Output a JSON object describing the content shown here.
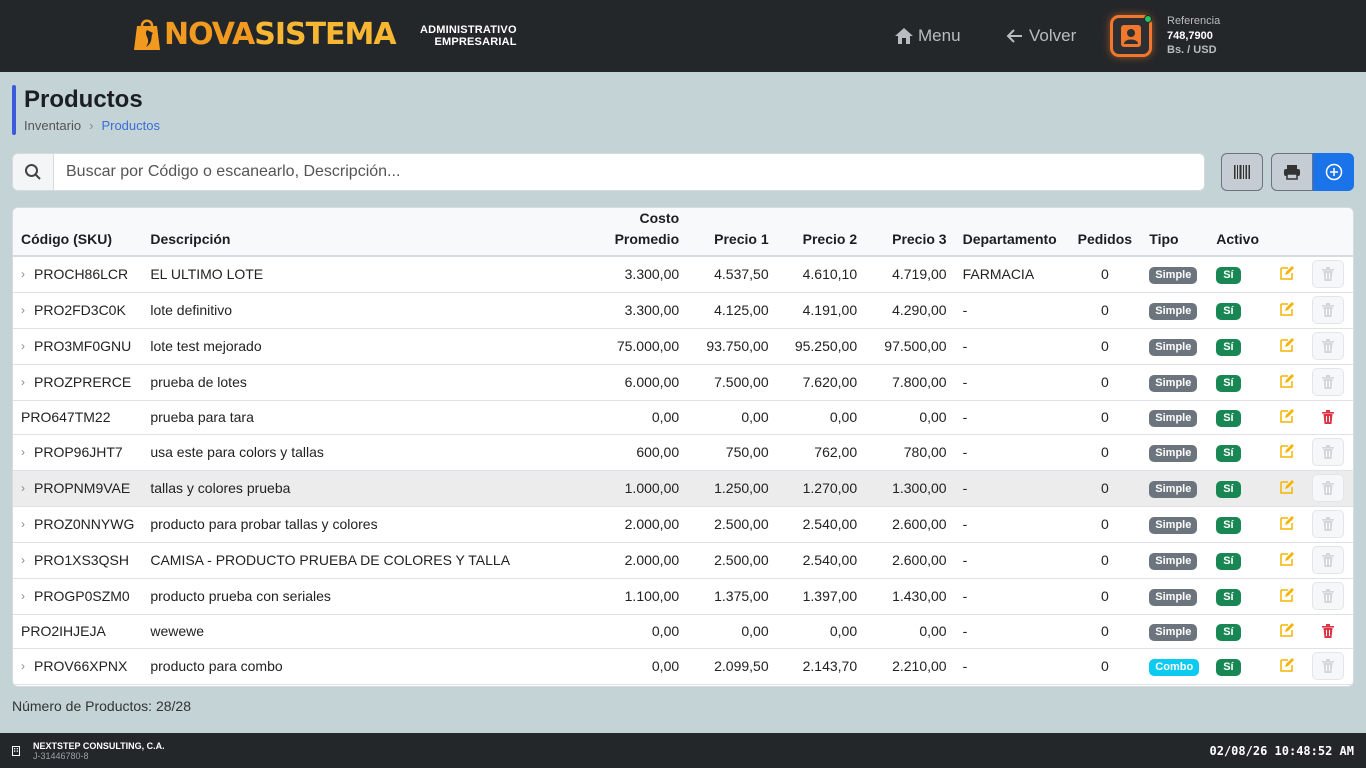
{
  "header": {
    "logo_part1": "NOVA",
    "logo_part2": "SISTEMA",
    "tagline_line1": "ADMINISTRATIVO",
    "tagline_line2": "EMPRESARIAL",
    "menu_label": "Menu",
    "back_label": "Volver",
    "reference_label": "Referencia",
    "reference_value": "748,7900",
    "reference_unit": "Bs. / USD"
  },
  "page": {
    "title": "Productos",
    "breadcrumb": [
      "Inventario",
      "Productos"
    ]
  },
  "search": {
    "placeholder": "Buscar por Código o escanearlo, Descripción..."
  },
  "table": {
    "columns": [
      "Código (SKU)",
      "Descripción",
      "Costo Promedio",
      "Precio 1",
      "Precio 2",
      "Precio 3",
      "Departamento",
      "Pedidos",
      "Tipo",
      "Activo"
    ],
    "rows": [
      {
        "sku": "PROCH86LCR",
        "desc": "EL ULTIMO LOTE",
        "cost": "3.300,00",
        "p1": "4.537,50",
        "p2": "4.610,10",
        "p3": "4.719,00",
        "dept": "FARMACIA",
        "orders": "0",
        "type": "Simple",
        "active": "Sí"
      },
      {
        "sku": "PRO2FD3C0K",
        "desc": "lote definitivo",
        "cost": "3.300,00",
        "p1": "4.125,00",
        "p2": "4.191,00",
        "p3": "4.290,00",
        "dept": "-",
        "orders": "0",
        "type": "Simple",
        "active": "Sí"
      },
      {
        "sku": "PRO3MF0GNU",
        "desc": "lote test mejorado",
        "cost": "75.000,00",
        "p1": "93.750,00",
        "p2": "95.250,00",
        "p3": "97.500,00",
        "dept": "-",
        "orders": "0",
        "type": "Simple",
        "active": "Sí"
      },
      {
        "sku": "PROZPRERCE",
        "desc": "prueba de lotes",
        "cost": "6.000,00",
        "p1": "7.500,00",
        "p2": "7.620,00",
        "p3": "7.800,00",
        "dept": "-",
        "orders": "0",
        "type": "Simple",
        "active": "Sí"
      },
      {
        "sku": "PRO647TM22",
        "desc": "prueba para tara",
        "cost": "0,00",
        "p1": "0,00",
        "p2": "0,00",
        "p3": "0,00",
        "dept": "-",
        "orders": "0",
        "type": "Simple",
        "active": "Sí"
      },
      {
        "sku": "PROP96JHT7",
        "desc": "usa este para colors y tallas",
        "cost": "600,00",
        "p1": "750,00",
        "p2": "762,00",
        "p3": "780,00",
        "dept": "-",
        "orders": "0",
        "type": "Simple",
        "active": "Sí"
      },
      {
        "sku": "PROPNM9VAE",
        "desc": "tallas y colores prueba",
        "cost": "1.000,00",
        "p1": "1.250,00",
        "p2": "1.270,00",
        "p3": "1.300,00",
        "dept": "-",
        "orders": "0",
        "type": "Simple",
        "active": "Sí"
      },
      {
        "sku": "PROZ0NNYWG",
        "desc": "producto para probar tallas y colores",
        "cost": "2.000,00",
        "p1": "2.500,00",
        "p2": "2.540,00",
        "p3": "2.600,00",
        "dept": "-",
        "orders": "0",
        "type": "Simple",
        "active": "Sí"
      },
      {
        "sku": "PRO1XS3QSH",
        "desc": "CAMISA - PRODUCTO PRUEBA DE COLORES Y TALLA",
        "cost": "2.000,00",
        "p1": "2.500,00",
        "p2": "2.540,00",
        "p3": "2.600,00",
        "dept": "-",
        "orders": "0",
        "type": "Simple",
        "active": "Sí"
      },
      {
        "sku": "PROGP0SZM0",
        "desc": "producto prueba con seriales",
        "cost": "1.100,00",
        "p1": "1.375,00",
        "p2": "1.397,00",
        "p3": "1.430,00",
        "dept": "-",
        "orders": "0",
        "type": "Simple",
        "active": "Sí"
      },
      {
        "sku": "PRO2IHJEJA",
        "desc": "wewewe",
        "cost": "0,00",
        "p1": "0,00",
        "p2": "0,00",
        "p3": "0,00",
        "dept": "-",
        "orders": "0",
        "type": "Simple",
        "active": "Sí"
      },
      {
        "sku": "PROV66XPNX",
        "desc": "producto para combo",
        "cost": "0,00",
        "p1": "2.099,50",
        "p2": "2.143,70",
        "p3": "2.210,00",
        "dept": "-",
        "orders": "0",
        "type": "Combo",
        "active": "Sí"
      }
    ]
  },
  "summary": {
    "count_label": "Número de Productos: 28/28"
  },
  "footer": {
    "company": "NEXTSTEP CONSULTING, C.A.",
    "rif": "J-31446780-8",
    "datetime": "02/08/26 10:48:52 AM"
  },
  "colors": {
    "accent": "#1a73e8",
    "brand_orange": "#f29a1f",
    "active_green": "#198754",
    "simple_gray": "#6c757d",
    "combo_cyan": "#0dcaf0",
    "delete_red": "#dc3545"
  }
}
